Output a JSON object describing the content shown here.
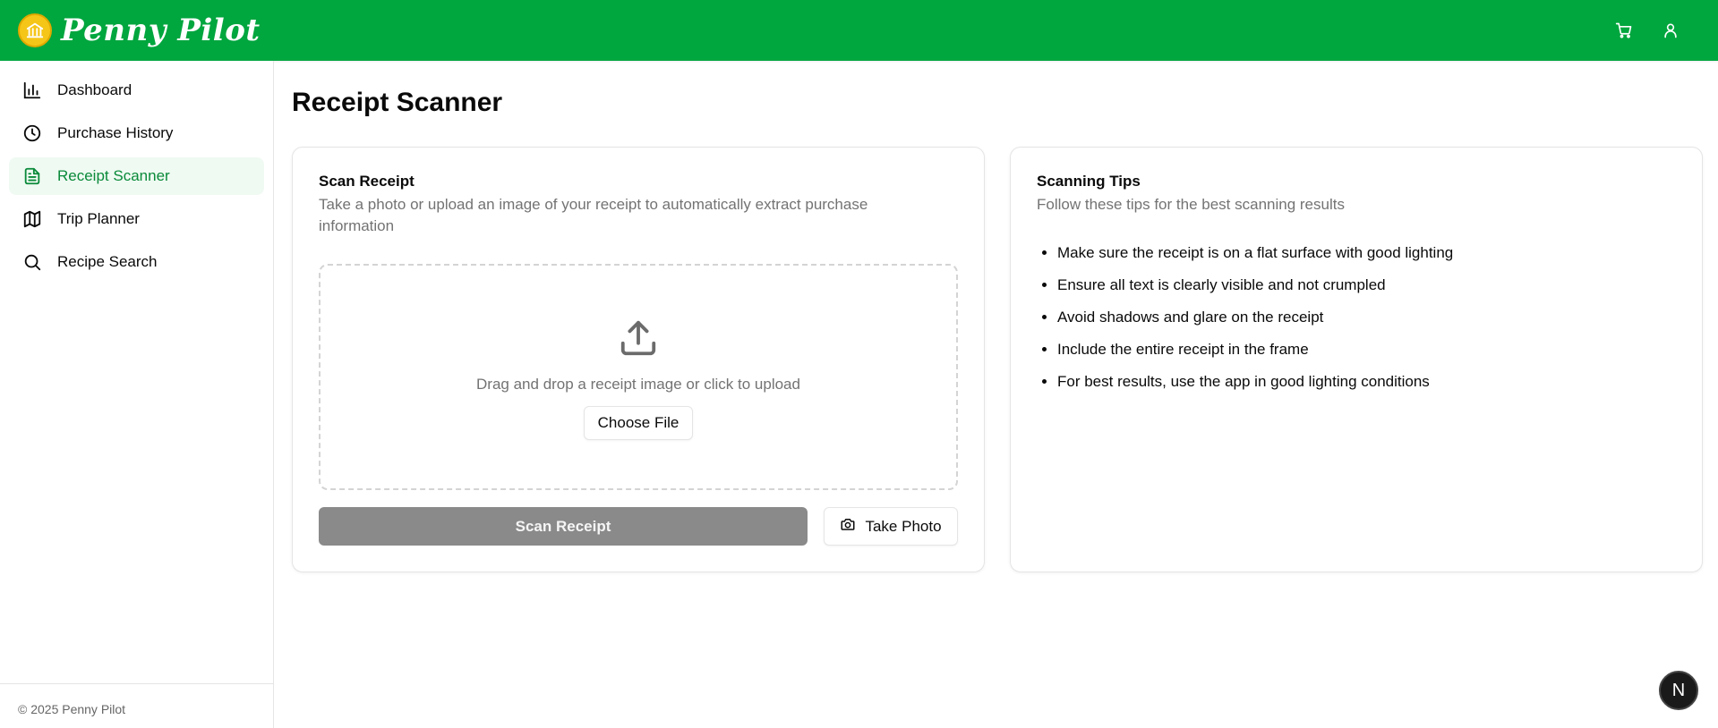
{
  "header": {
    "brand": "Penny Pilot",
    "icons": [
      "bank-icon",
      "cart-icon",
      "user-icon"
    ],
    "color": "#00a63e"
  },
  "sidebar": {
    "items": [
      {
        "label": "Dashboard",
        "icon": "bar-chart-icon",
        "active": false
      },
      {
        "label": "Purchase History",
        "icon": "clock-icon",
        "active": false
      },
      {
        "label": "Receipt Scanner",
        "icon": "file-text-icon",
        "active": true
      },
      {
        "label": "Trip Planner",
        "icon": "map-icon",
        "active": false
      },
      {
        "label": "Recipe Search",
        "icon": "search-icon",
        "active": false
      }
    ],
    "footer": "© 2025 Penny Pilot"
  },
  "main": {
    "title": "Receipt Scanner",
    "scan_card": {
      "title": "Scan Receipt",
      "description": "Take a photo or upload an image of your receipt to automatically extract purchase information",
      "drop_text": "Drag and drop a receipt image or click to upload",
      "choose_label": "Choose File",
      "scan_label": "Scan Receipt",
      "photo_label": "Take Photo"
    },
    "tips_card": {
      "title": "Scanning Tips",
      "description": "Follow these tips for the best scanning results",
      "tips": [
        "Make sure the receipt is on a flat surface with good lighting",
        "Ensure all text is clearly visible and not crumpled",
        "Avoid shadows and glare on the receipt",
        "Include the entire receipt in the frame",
        "For best results, use the app in good lighting conditions"
      ]
    }
  },
  "badge": "N"
}
